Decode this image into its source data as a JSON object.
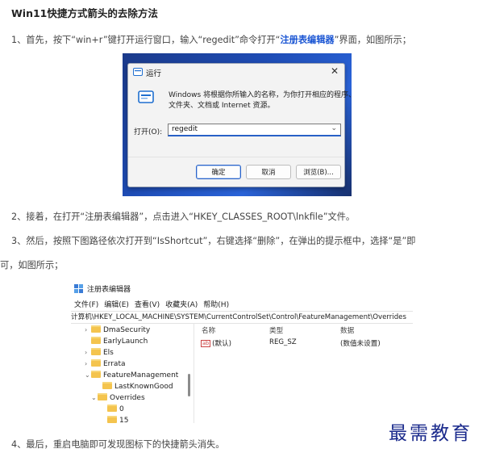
{
  "article": {
    "title": "Win11快捷方式箭头的去除方法",
    "step1_prefix": "1、首先，按下“win+r”键打开运行窗口，输入“regedit”命令打开“",
    "step1_link": "注册表编辑器",
    "step1_suffix": "”界面，如图所示；",
    "step2": "2、接着，在打开“注册表编辑器”，点击进入“HKEY_CLASSES_ROOT\\lnkfile”文件。",
    "step3_line1": "3、然后，按照下图路径依次打开到“IsShortcut”，右键选择“删除”，在弹出的提示框中，选择“是”即",
    "step3_line2": "可，如图所示；",
    "step4": "4、最后，重启电脑即可发现图标下的快捷箭头消失。"
  },
  "run_dialog": {
    "title": "运行",
    "desc_line1": "Windows 将根据你所输入的名称，为你打开相应的程序、",
    "desc_line2": "文件夹、文档或 Internet 资源。",
    "open_label": "打开(O):",
    "input_value": "regedit",
    "ok_label": "确定",
    "cancel_label": "取消",
    "browse_label": "浏览(B)..."
  },
  "regedit": {
    "title": "注册表编辑器",
    "menu": [
      "文件(F)",
      "编辑(E)",
      "查看(V)",
      "收藏夹(A)",
      "帮助(H)"
    ],
    "address": "计算机\\HKEY_LOCAL_MACHINE\\SYSTEM\\CurrentControlSet\\Control\\FeatureManagement\\Overrides",
    "tree": [
      {
        "label": "DmaSecurity",
        "chevron": "›"
      },
      {
        "label": "EarlyLaunch",
        "chevron": ""
      },
      {
        "label": "Els",
        "chevron": "›"
      },
      {
        "label": "Errata",
        "chevron": "›"
      },
      {
        "label": "FeatureManagement",
        "chevron": "⌄"
      },
      {
        "label": "LastKnownGood",
        "chevron": ""
      },
      {
        "label": "Overrides",
        "chevron": "⌄"
      },
      {
        "label": "0",
        "chevron": ""
      },
      {
        "label": "15",
        "chevron": ""
      }
    ],
    "columns": {
      "name": "名称",
      "type": "类型",
      "data": "数据"
    },
    "row": {
      "icon": "ab",
      "name": "(默认)",
      "type": "REG_SZ",
      "data": "(数值未设置)"
    }
  },
  "watermark": "最需教育"
}
